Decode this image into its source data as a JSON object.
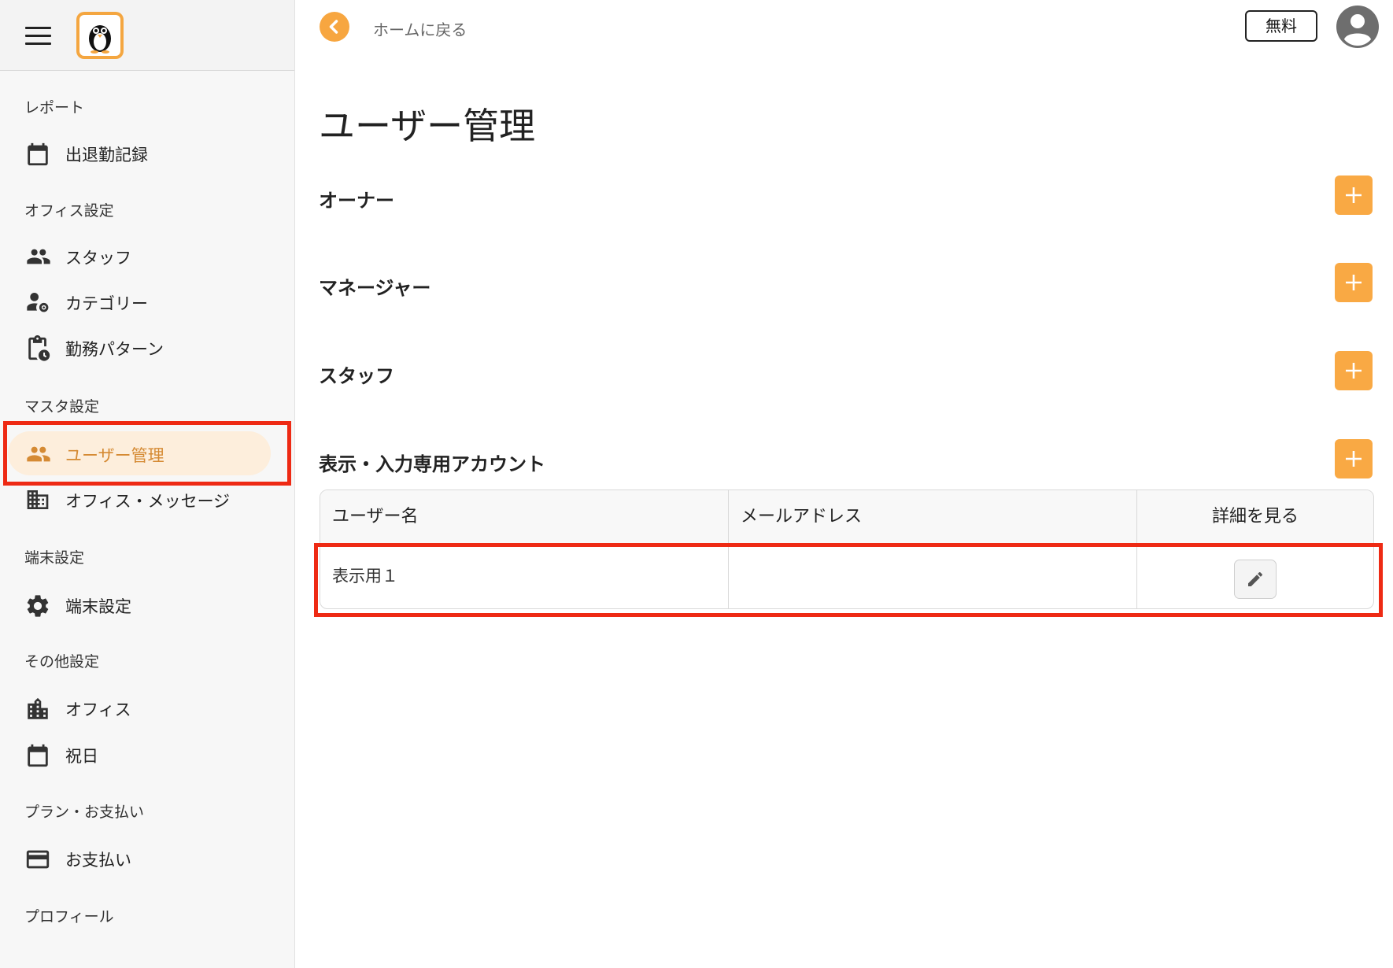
{
  "sidebar": {
    "sections": [
      {
        "title": "レポート",
        "items": [
          {
            "label": "出退勤記録",
            "icon": "calendar-icon"
          }
        ]
      },
      {
        "title": "オフィス設定",
        "items": [
          {
            "label": "スタッフ",
            "icon": "people-icon"
          },
          {
            "label": "カテゴリー",
            "icon": "person-gear-icon"
          },
          {
            "label": "勤務パターン",
            "icon": "clipboard-clock-icon"
          }
        ]
      },
      {
        "title": "マスタ設定",
        "items": [
          {
            "label": "ユーザー管理",
            "icon": "people-icon",
            "active": true
          },
          {
            "label": "オフィス・メッセージ",
            "icon": "building-icon"
          }
        ]
      },
      {
        "title": "端末設定",
        "items": [
          {
            "label": "端末設定",
            "icon": "gear-icon"
          }
        ]
      },
      {
        "title": "その他設定",
        "items": [
          {
            "label": "オフィス",
            "icon": "city-icon"
          },
          {
            "label": "祝日",
            "icon": "calendar-icon"
          }
        ]
      },
      {
        "title": "プラン・お支払い",
        "items": [
          {
            "label": "お支払い",
            "icon": "credit-card-icon"
          }
        ]
      },
      {
        "title": "プロフィール",
        "items": []
      }
    ]
  },
  "topbar": {
    "back_label": "ホームに戻る",
    "plan_badge": "無料"
  },
  "main": {
    "title": "ユーザー管理",
    "sections": [
      {
        "title": "オーナー"
      },
      {
        "title": "マネージャー"
      },
      {
        "title": "スタッフ"
      },
      {
        "title": "表示・入力専用アカウント"
      }
    ],
    "table": {
      "headers": [
        "ユーザー名",
        "メールアドレス",
        "詳細を見る"
      ],
      "rows": [
        {
          "username": "表示用１",
          "email": ""
        }
      ]
    }
  },
  "colors": {
    "accent": "#f7a640",
    "active_bg": "#fdeedc",
    "active_text": "#d58a33",
    "highlight": "#ee2a14"
  }
}
